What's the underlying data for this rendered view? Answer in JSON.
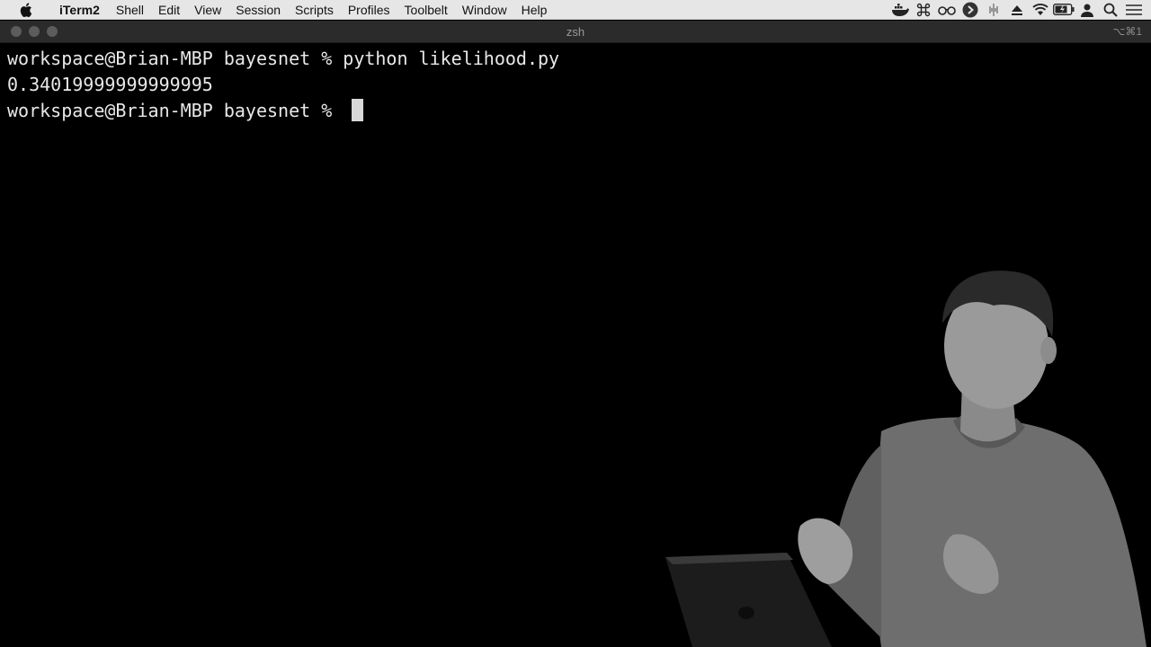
{
  "menubar": {
    "app_name": "iTerm2",
    "items": [
      "Shell",
      "Edit",
      "View",
      "Session",
      "Scripts",
      "Profiles",
      "Toolbelt",
      "Window",
      "Help"
    ],
    "status_icons": [
      "docker-icon",
      "command-icon",
      "glasses-icon",
      "forward-icon",
      "sound-icon",
      "eject-icon",
      "wifi-icon",
      "battery-icon",
      "user-icon",
      "search-icon",
      "control-center-icon"
    ]
  },
  "window": {
    "title": "zsh",
    "shortcut": "⌥⌘1"
  },
  "terminal": {
    "lines": [
      "workspace@Brian-MBP bayesnet % python likelihood.py",
      "0.34019999999999995",
      "workspace@Brian-MBP bayesnet % "
    ]
  }
}
